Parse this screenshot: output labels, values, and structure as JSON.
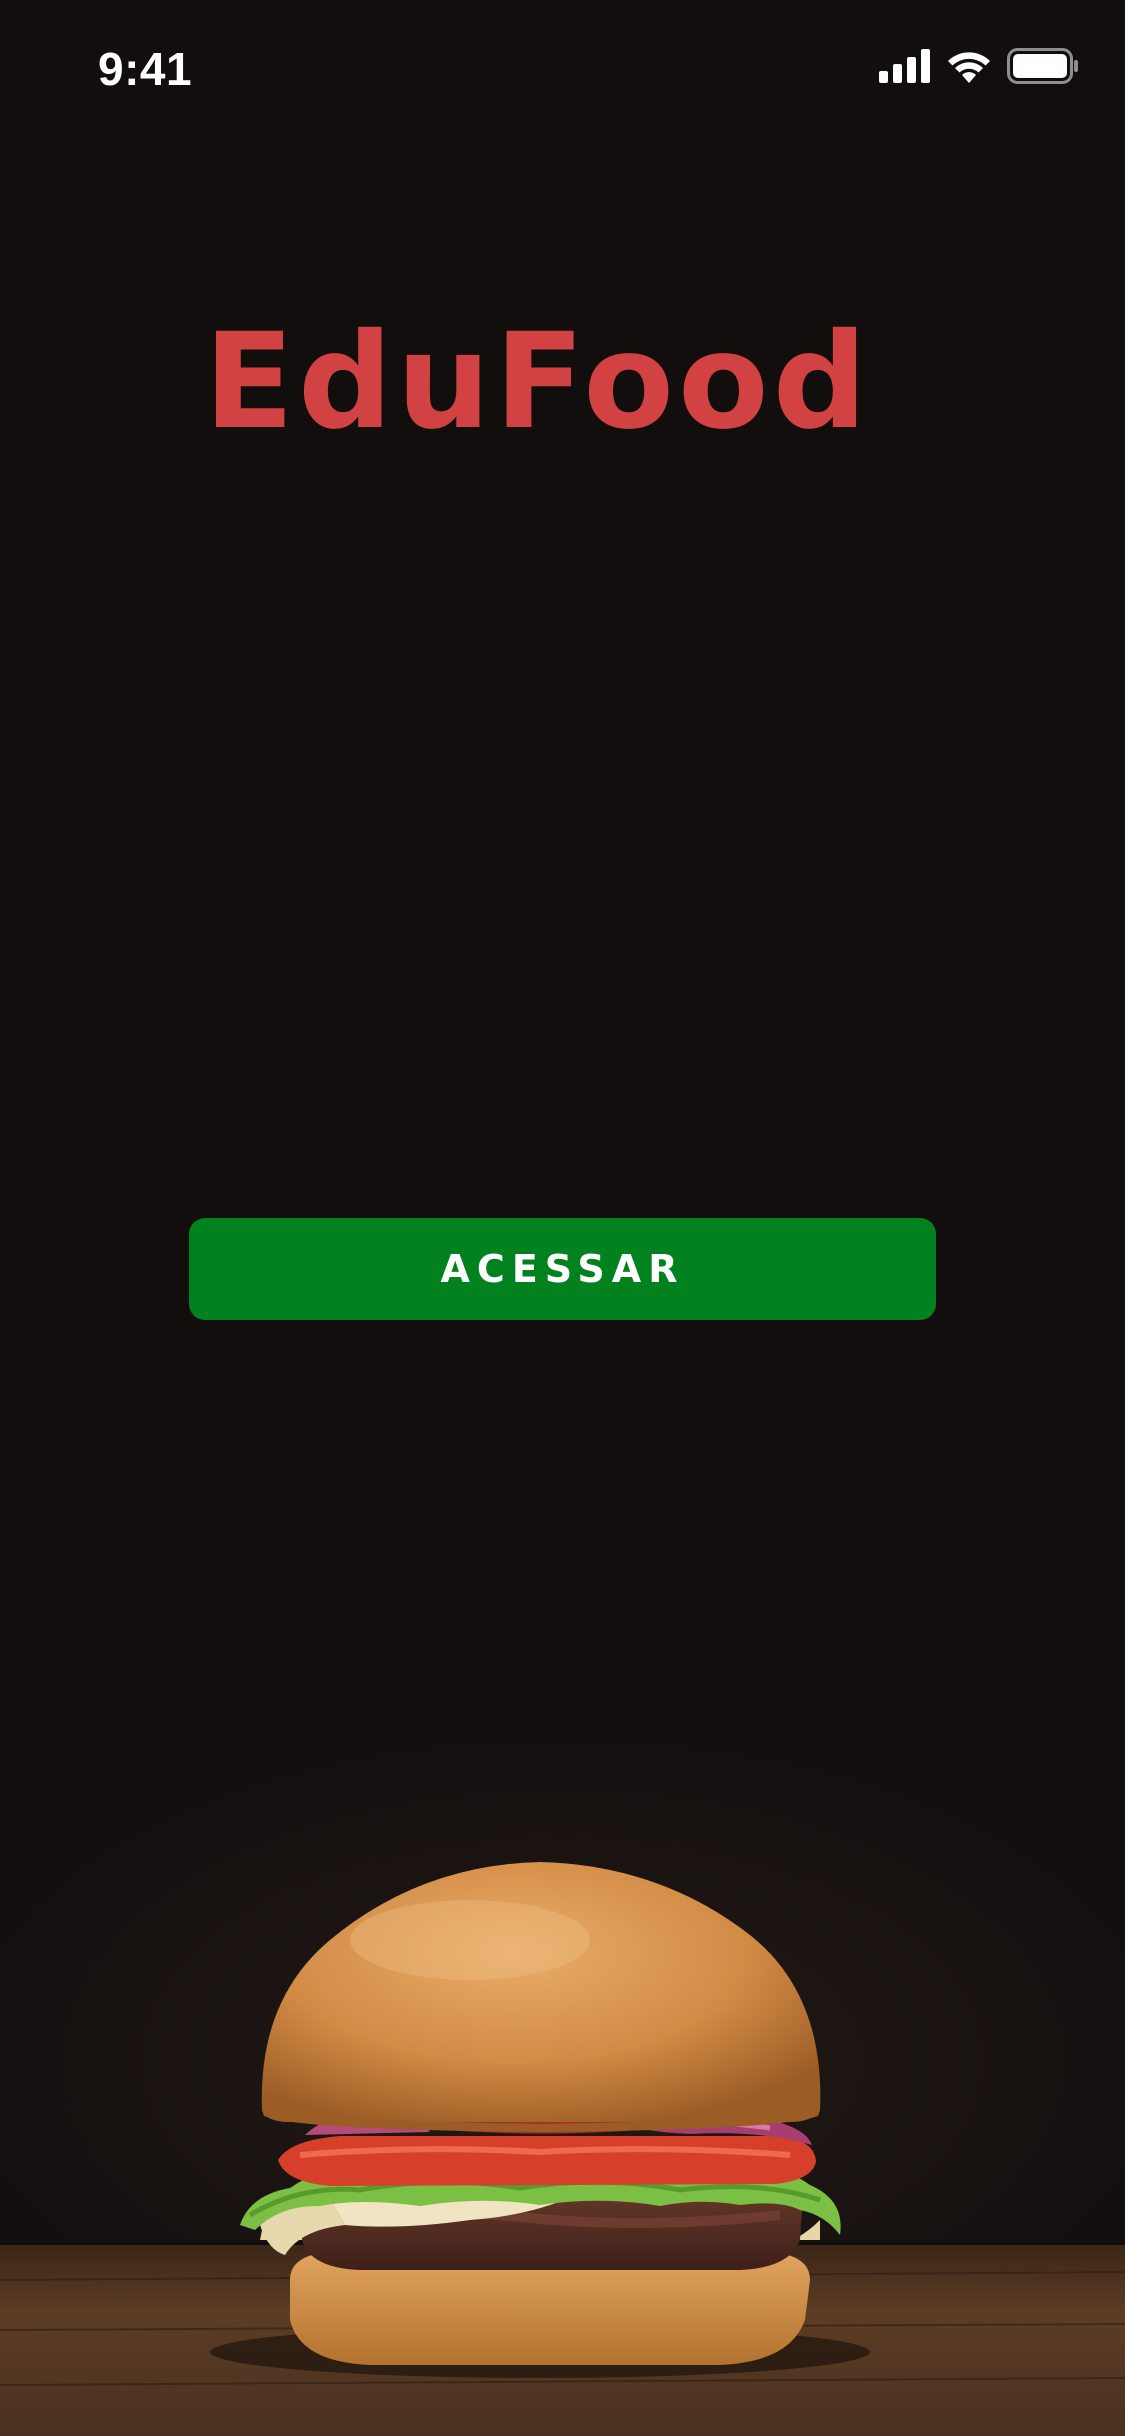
{
  "status_bar": {
    "time": "9:41",
    "icons": [
      "cellular-signal-icon",
      "wifi-icon",
      "battery-icon"
    ]
  },
  "app": {
    "title": "EduFood",
    "title_color": "#d34242",
    "background_color": "#120e0e"
  },
  "actions": {
    "access_label": "ACESSAR",
    "access_color": "#01821f"
  },
  "hero": {
    "image": "burger-image"
  }
}
